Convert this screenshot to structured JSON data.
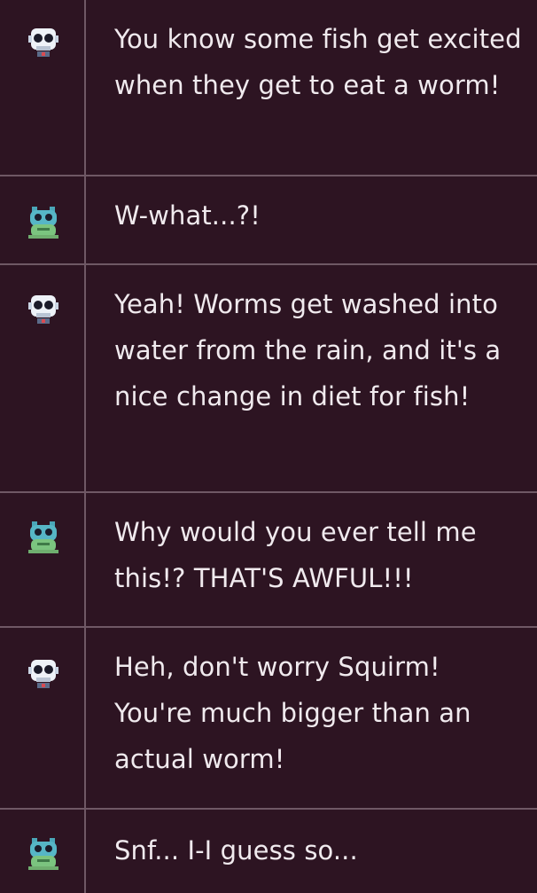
{
  "colors": {
    "background": "#2d1422",
    "divider": "#6f5865",
    "text": "#f0eaee"
  },
  "dialogue": [
    {
      "speaker_icon": "skull-robot-icon",
      "text": "You know some fish get excited when they get to eat a worm!"
    },
    {
      "speaker_icon": "worm-frog-icon",
      "text": "W-what...?!"
    },
    {
      "speaker_icon": "skull-robot-icon",
      "text": "Yeah! Worms get washed into water from the rain, and it's a nice change in diet for fish!"
    },
    {
      "speaker_icon": "worm-frog-icon",
      "text": "Why would you ever tell me this!? THAT'S AWFUL!!!"
    },
    {
      "speaker_icon": "skull-robot-icon",
      "text": "Heh, don't worry Squirm! You're much bigger than an actual worm!"
    },
    {
      "speaker_icon": "worm-frog-icon",
      "text": "Snf... I-I guess so..."
    }
  ]
}
